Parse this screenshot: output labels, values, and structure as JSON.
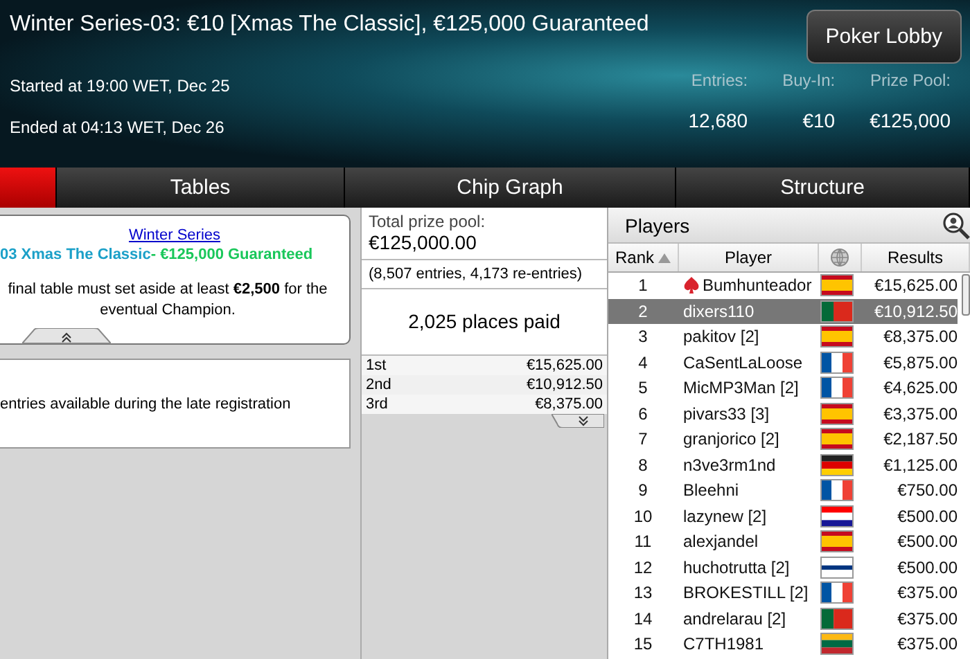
{
  "header": {
    "title": "Winter Series-03: €10 [Xmas The Classic], €125,000 Guaranteed",
    "lobby_button": "Poker Lobby",
    "started": "Started at 19:00 WET, Dec 25",
    "ended": "Ended at 04:13 WET, Dec 26",
    "stats": [
      {
        "label": "Entries:",
        "value": "12,680"
      },
      {
        "label": "Buy-In:",
        "value": "€10"
      },
      {
        "label": "Prize Pool:",
        "value": "€125,000"
      }
    ]
  },
  "tabs": [
    {
      "selected": true
    },
    {
      "label": "Tables",
      "selected": false
    },
    {
      "label": "Chip Graph",
      "selected": false
    },
    {
      "label": "Structure",
      "selected": false
    }
  ],
  "info": {
    "link": "Winter Series",
    "subtitle": "03 Xmas The Classic",
    "guarantee": "- €125,000 Guaranteed",
    "note": "final table must set aside at least **€2,500** for the eventual Champion.",
    "note2": "entries available during the late registration"
  },
  "prizes": {
    "label": "Total prize pool:",
    "total": "€125,000.00",
    "entries": "(8,507 entries, 4,173 re-entries)",
    "places": "2,025 places paid",
    "rows": [
      {
        "place": "1st",
        "amount": "€15,625.00"
      },
      {
        "place": "2nd",
        "amount": "€10,912.50"
      },
      {
        "place": "3rd",
        "amount": "€8,375.00"
      }
    ]
  },
  "players": {
    "title": "Players",
    "columns": [
      "Rank",
      "Player",
      "Results"
    ],
    "rows": [
      {
        "rank": "1",
        "name": "Bumhunteador",
        "kind": "es",
        "pro": true,
        "result": "€15,625.00",
        "selected": false
      },
      {
        "rank": "2",
        "name": "dixers110",
        "kind": "pt",
        "pro": false,
        "result": "€10,912.50",
        "selected": true
      },
      {
        "rank": "3",
        "name": "pakitov [2]",
        "kind": "es",
        "pro": false,
        "result": "€8,375.00",
        "selected": false
      },
      {
        "rank": "4",
        "name": "CaSentLaLoose",
        "kind": "fr",
        "pro": false,
        "result": "€5,875.00",
        "selected": false
      },
      {
        "rank": "5",
        "name": "MicMP3Man [2]",
        "kind": "fr",
        "pro": false,
        "result": "€4,625.00",
        "selected": false
      },
      {
        "rank": "6",
        "name": "pivars33 [3]",
        "kind": "es",
        "pro": false,
        "result": "€3,375.00",
        "selected": false
      },
      {
        "rank": "7",
        "name": "granjorico [2]",
        "kind": "es",
        "pro": false,
        "result": "€2,187.50",
        "selected": false
      },
      {
        "rank": "8",
        "name": "n3ve3rm1nd",
        "kind": "de",
        "pro": false,
        "result": "€1,125.00",
        "selected": false
      },
      {
        "rank": "9",
        "name": "Bleehni",
        "kind": "fr",
        "pro": false,
        "result": "€750.00",
        "selected": false
      },
      {
        "rank": "10",
        "name": "lazynew [2]",
        "kind": "hr",
        "pro": false,
        "result": "€500.00",
        "selected": false
      },
      {
        "rank": "11",
        "name": "alexjandel",
        "kind": "es",
        "pro": false,
        "result": "€500.00",
        "selected": false
      },
      {
        "rank": "12",
        "name": "huchotrutta [2]",
        "kind": "fi",
        "pro": false,
        "result": "€500.00",
        "selected": false
      },
      {
        "rank": "13",
        "name": "BROKESTILL [2]",
        "kind": "fr",
        "pro": false,
        "result": "€375.00",
        "selected": false
      },
      {
        "rank": "14",
        "name": "andrelarau [2]",
        "kind": "pt",
        "pro": false,
        "result": "€375.00",
        "selected": false
      },
      {
        "rank": "15",
        "name": "C7TH1981",
        "kind": "lt",
        "pro": false,
        "result": "€375.00",
        "selected": false
      }
    ]
  }
}
